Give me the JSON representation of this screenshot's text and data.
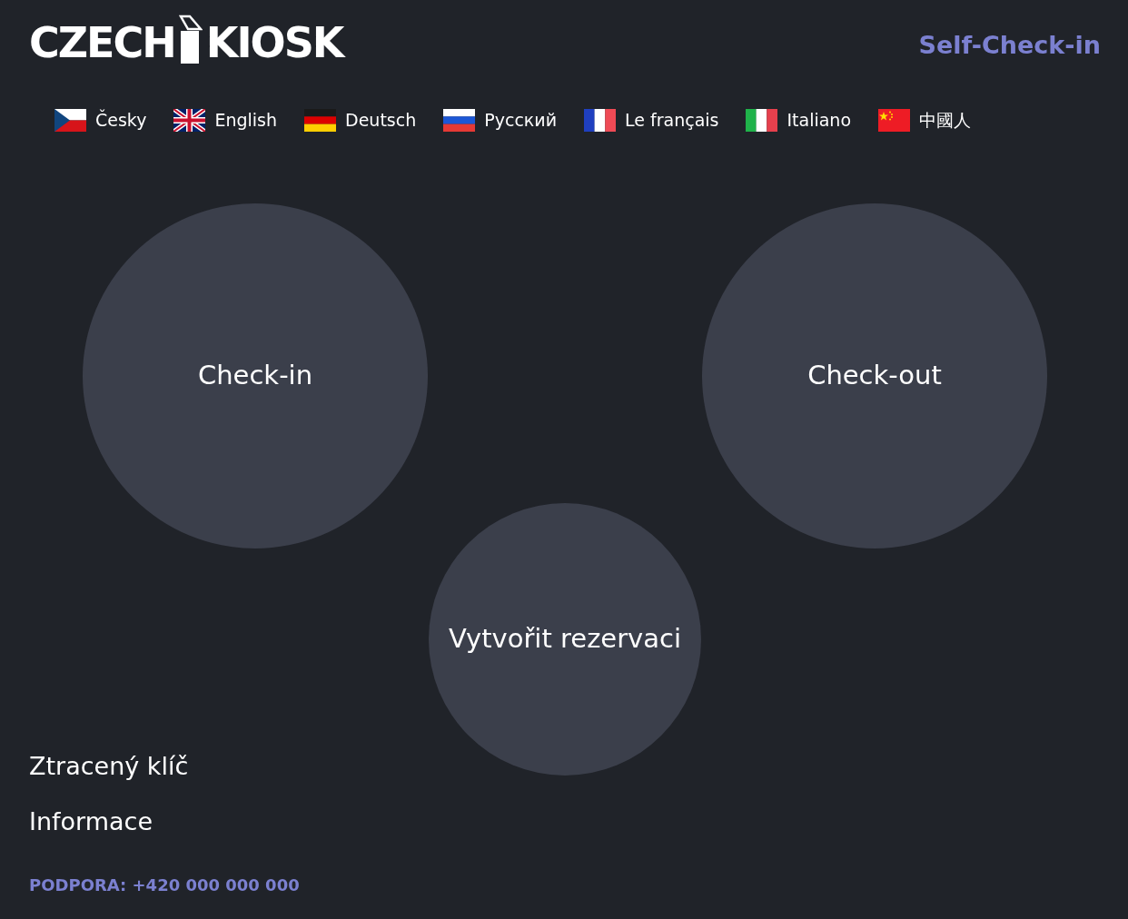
{
  "logo": {
    "word_1": "CZECH",
    "word_2": "KIOSK"
  },
  "header": {
    "title": "Self-Check-in"
  },
  "languages": [
    {
      "kind": "cz",
      "label": "Česky"
    },
    {
      "kind": "gb",
      "label": "English"
    },
    {
      "kind": "de",
      "label": "Deutsch"
    },
    {
      "kind": "ru",
      "label": "Русский"
    },
    {
      "kind": "fr",
      "label": "Le français"
    },
    {
      "kind": "it",
      "label": "Italiano"
    },
    {
      "kind": "cn",
      "label": "中國人"
    }
  ],
  "actions": [
    {
      "kind": "large",
      "label": "Check-in"
    },
    {
      "kind": "large",
      "label": "Check-out"
    },
    {
      "kind": "small",
      "label": "Vytvořit rezervaci"
    }
  ],
  "links": [
    "Ztracený klíč",
    "Informace"
  ],
  "support": "PODPORA: +420 000 000 000"
}
